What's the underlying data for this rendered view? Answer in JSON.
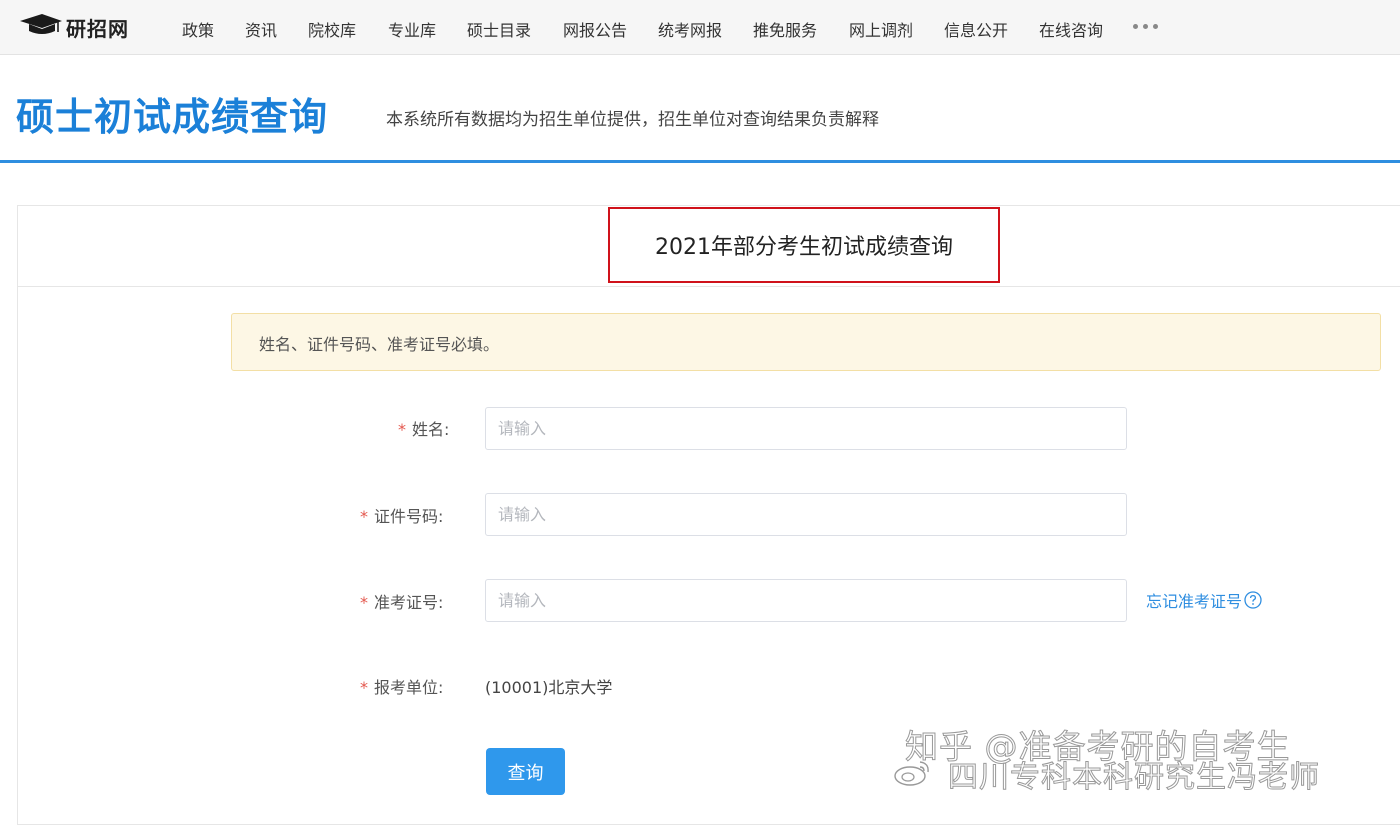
{
  "brand": {
    "name": "研招网"
  },
  "nav": {
    "items": [
      {
        "label": "政策"
      },
      {
        "label": "资讯"
      },
      {
        "label": "院校库"
      },
      {
        "label": "专业库"
      },
      {
        "label": "硕士目录"
      },
      {
        "label": "网报公告"
      },
      {
        "label": "统考网报"
      },
      {
        "label": "推免服务"
      },
      {
        "label": "网上调剂"
      },
      {
        "label": "信息公开"
      },
      {
        "label": "在线咨询"
      }
    ],
    "more_icon": "more-dots-icon"
  },
  "header": {
    "title": "硕士初试成绩查询",
    "subtitle": "本系统所有数据均为招生单位提供，招生单位对查询结果负责解释"
  },
  "card": {
    "title": "2021年部分考生初试成绩查询",
    "notice": "姓名、证件号码、准考证号必填。"
  },
  "form": {
    "required_mark": "*",
    "name": {
      "label": "姓名:",
      "placeholder": "请输入",
      "value": ""
    },
    "id_number": {
      "label": "证件号码:",
      "placeholder": "请输入",
      "value": ""
    },
    "exam_number": {
      "label": "准考证号:",
      "placeholder": "请输入",
      "value": ""
    },
    "forgot_link": "忘记准考证号",
    "unit": {
      "label": "报考单位:",
      "value": "(10001)北京大学"
    },
    "submit_label": "查询"
  },
  "watermark": {
    "line1": "知乎 @准备考研的自考生",
    "line2": "四川专科本科研究生冯老师"
  },
  "colors": {
    "accent": "#1b80d8",
    "button": "#2f98ec",
    "highlight_border": "#d0121b",
    "notice_bg": "#fdf7e5",
    "required": "#e4574d"
  }
}
